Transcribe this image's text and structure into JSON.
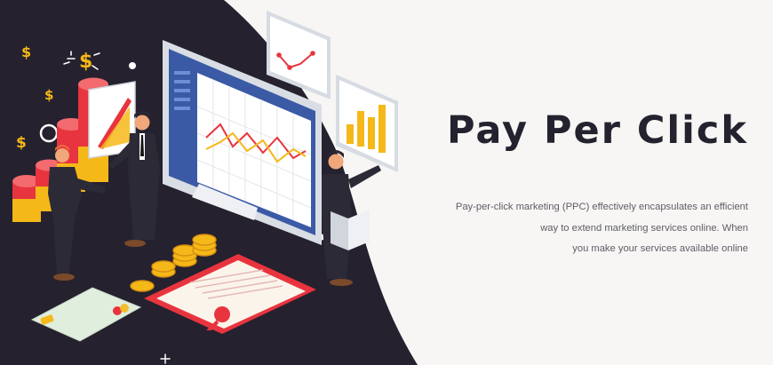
{
  "hero": {
    "title": "Pay Per Click",
    "description_lines": [
      "Pay-per-click marketing (PPC) effectively encapsulates an efficient",
      "way to extend marketing services online. When",
      "you make your services available online"
    ],
    "illustration_icons": [
      "dollar-sign-icon",
      "coin-stack-icon",
      "bar-chart-icon",
      "line-chart-icon",
      "certificate-icon",
      "credit-card-icon",
      "monitor-icon",
      "sparkle-icon"
    ]
  },
  "colors": {
    "background": "#f7f6f4",
    "dark_panel": "#25212f",
    "accent_yellow": "#f5b819",
    "accent_red": "#e8343e",
    "title_text": "#24222e",
    "body_text": "#5f5d66"
  }
}
